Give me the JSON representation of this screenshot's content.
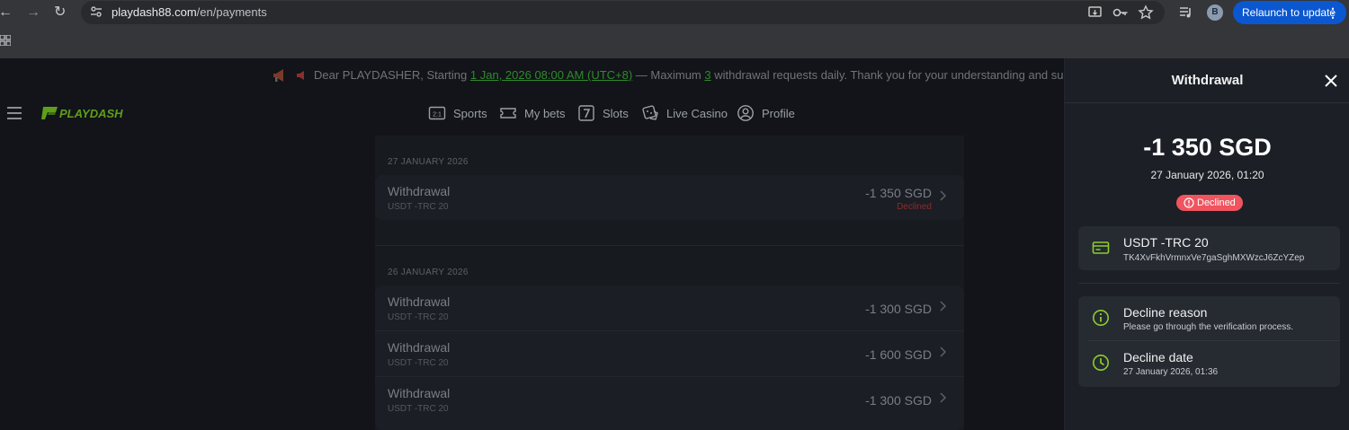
{
  "browser": {
    "url_domain": "playdash88.com",
    "url_path": "/en/payments",
    "profile_initial": "B",
    "relaunch_label": "Relaunch to update",
    "relaunch_menu": "⋮",
    "icons": [
      "back-arrow-icon",
      "forward-arrow-icon",
      "reload-icon",
      "site-info-icon",
      "install-app-icon",
      "key-icon",
      "star-icon",
      "media-control-icon",
      "apps-grid-icon"
    ]
  },
  "announcement": {
    "text_before": "Dear PLAYDASHER, Starting ",
    "date_link": "1 Jan, 2026 08:00 AM (UTC+8)",
    "text_middle": " — Maximum ",
    "count_link": "3",
    "text_after": " withdrawal requests daily. Thank you for your understanding and support!"
  },
  "nav": {
    "logo": "PLAYDASH",
    "items": [
      {
        "label": "Sports",
        "icon": "sports-score-icon"
      },
      {
        "label": "My bets",
        "icon": "ticket-icon"
      },
      {
        "label": "Slots",
        "icon": "slots-seven-icon"
      },
      {
        "label": "Live Casino",
        "icon": "dice-icon"
      },
      {
        "label": "Profile",
        "icon": "profile-icon"
      }
    ]
  },
  "transactions": {
    "groups": [
      {
        "date": "27 JANUARY 2026",
        "items": [
          {
            "title": "Withdrawal",
            "method": "USDT -TRC 20",
            "amount": "-1 350 SGD",
            "status": "Declined"
          }
        ]
      },
      {
        "date": "26 JANUARY 2026",
        "items": [
          {
            "title": "Withdrawal",
            "method": "USDT -TRC 20",
            "amount": "-1 300 SGD"
          },
          {
            "title": "Withdrawal",
            "method": "USDT -TRC 20",
            "amount": "-1 600 SGD"
          },
          {
            "title": "Withdrawal",
            "method": "USDT -TRC 20",
            "amount": "-1 300 SGD"
          }
        ]
      }
    ]
  },
  "drawer": {
    "title": "Withdrawal",
    "amount": "-1 350 SGD",
    "datetime": "27 January 2026, 01:20",
    "status": "Declined",
    "method": {
      "name": "USDT -TRC 20",
      "address": "TK4XvFkhVrmnxVe7gaSghMXWzcJ6ZcYZep"
    },
    "decline_reason": {
      "title": "Decline reason",
      "text": "Please go through the verification process."
    },
    "decline_date": {
      "title": "Decline date",
      "text": "27 January 2026, 01:36"
    }
  },
  "colors": {
    "accent_green": "#8ccc2e",
    "declined_red": "#f0545f",
    "relaunch_blue": "#0b57d0"
  }
}
